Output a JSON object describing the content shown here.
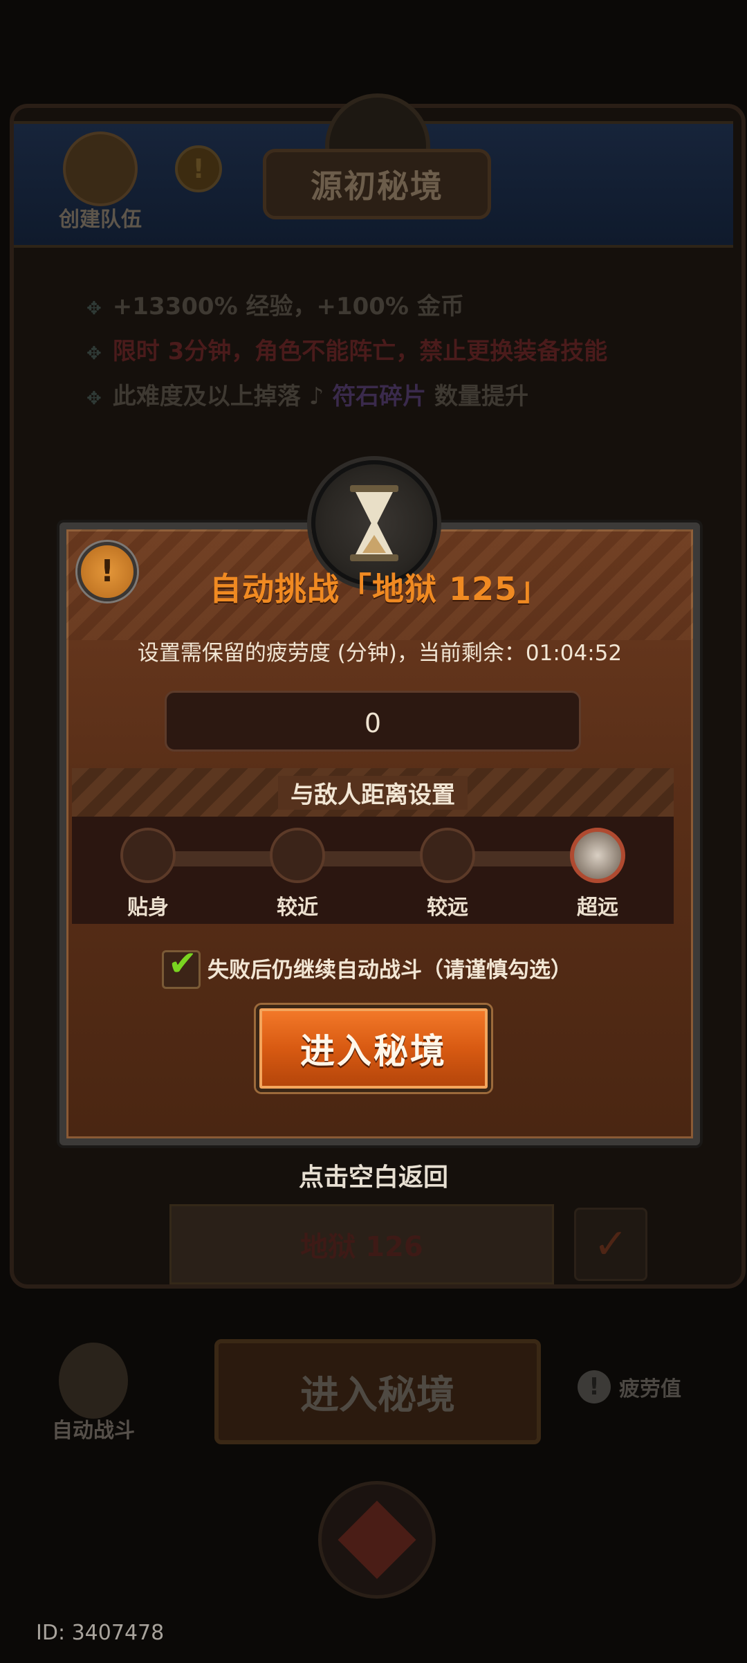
{
  "background": {
    "banner_title": "源初秘境",
    "create_team_label": "创建队伍",
    "info_lines": [
      {
        "text": "+13300% 经验，+100% 金币"
      },
      {
        "text": "限时 3分钟，角色不能阵亡，禁止更换装备技能"
      },
      {
        "prefix": "此难度及以上掉落",
        "highlight": "符石碎片",
        "suffix": "数量提升"
      }
    ],
    "stage_next": "地狱 126",
    "enter_button": "进入秘境",
    "auto_battle_label": "自动战斗",
    "fatigue_label": "疲劳值",
    "user_id": "ID: 3407478"
  },
  "dialog": {
    "title": "自动挑战「地狱 125」",
    "subtitle": "设置需保留的疲劳度 (分钟)，当前剩余：01:04:52",
    "fatigue_value": "0",
    "distance_header": "与敌人距离设置",
    "distance_options": [
      "贴身",
      "较近",
      "较远",
      "超远"
    ],
    "distance_selected_index": 3,
    "continue_checkbox_checked": true,
    "continue_checkbox_label": "失败后仍继续自动战斗（请谨慎勾选）",
    "enter_button": "进入秘境",
    "dismiss_hint": "点击空白返回"
  },
  "colors": {
    "title_orange": "#f08a22",
    "button_orange": "#d85a12",
    "checkmark_green": "#7ad421",
    "panel_brown": "#5a2f18"
  }
}
